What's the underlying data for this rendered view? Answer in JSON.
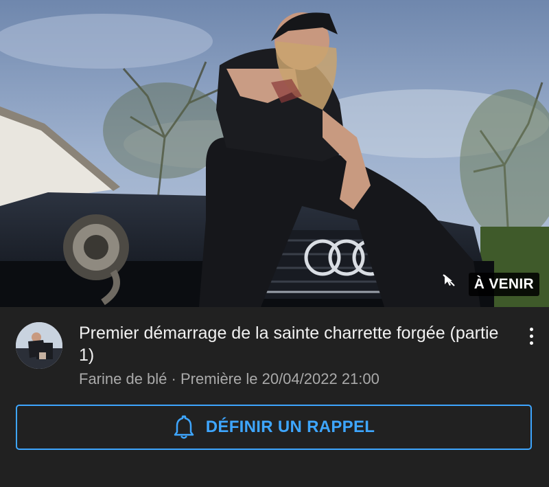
{
  "video": {
    "badge": "À VENIR",
    "title": "Premier démarrage de la sainte charrette forgée (partie 1)",
    "channel": "Farine de blé",
    "separator": "·",
    "premiere": "Première le 20/04/2022 21:00"
  },
  "actions": {
    "reminder_label": "DÉFINIR UN RAPPEL"
  },
  "icons": {
    "badge_icon": "pointer-icon",
    "reminder_icon": "bell-icon",
    "menu_icon": "more-vert-icon"
  },
  "colors": {
    "background": "#212121",
    "accent": "#3ea6ff",
    "secondary_text": "#aaaaaa"
  }
}
